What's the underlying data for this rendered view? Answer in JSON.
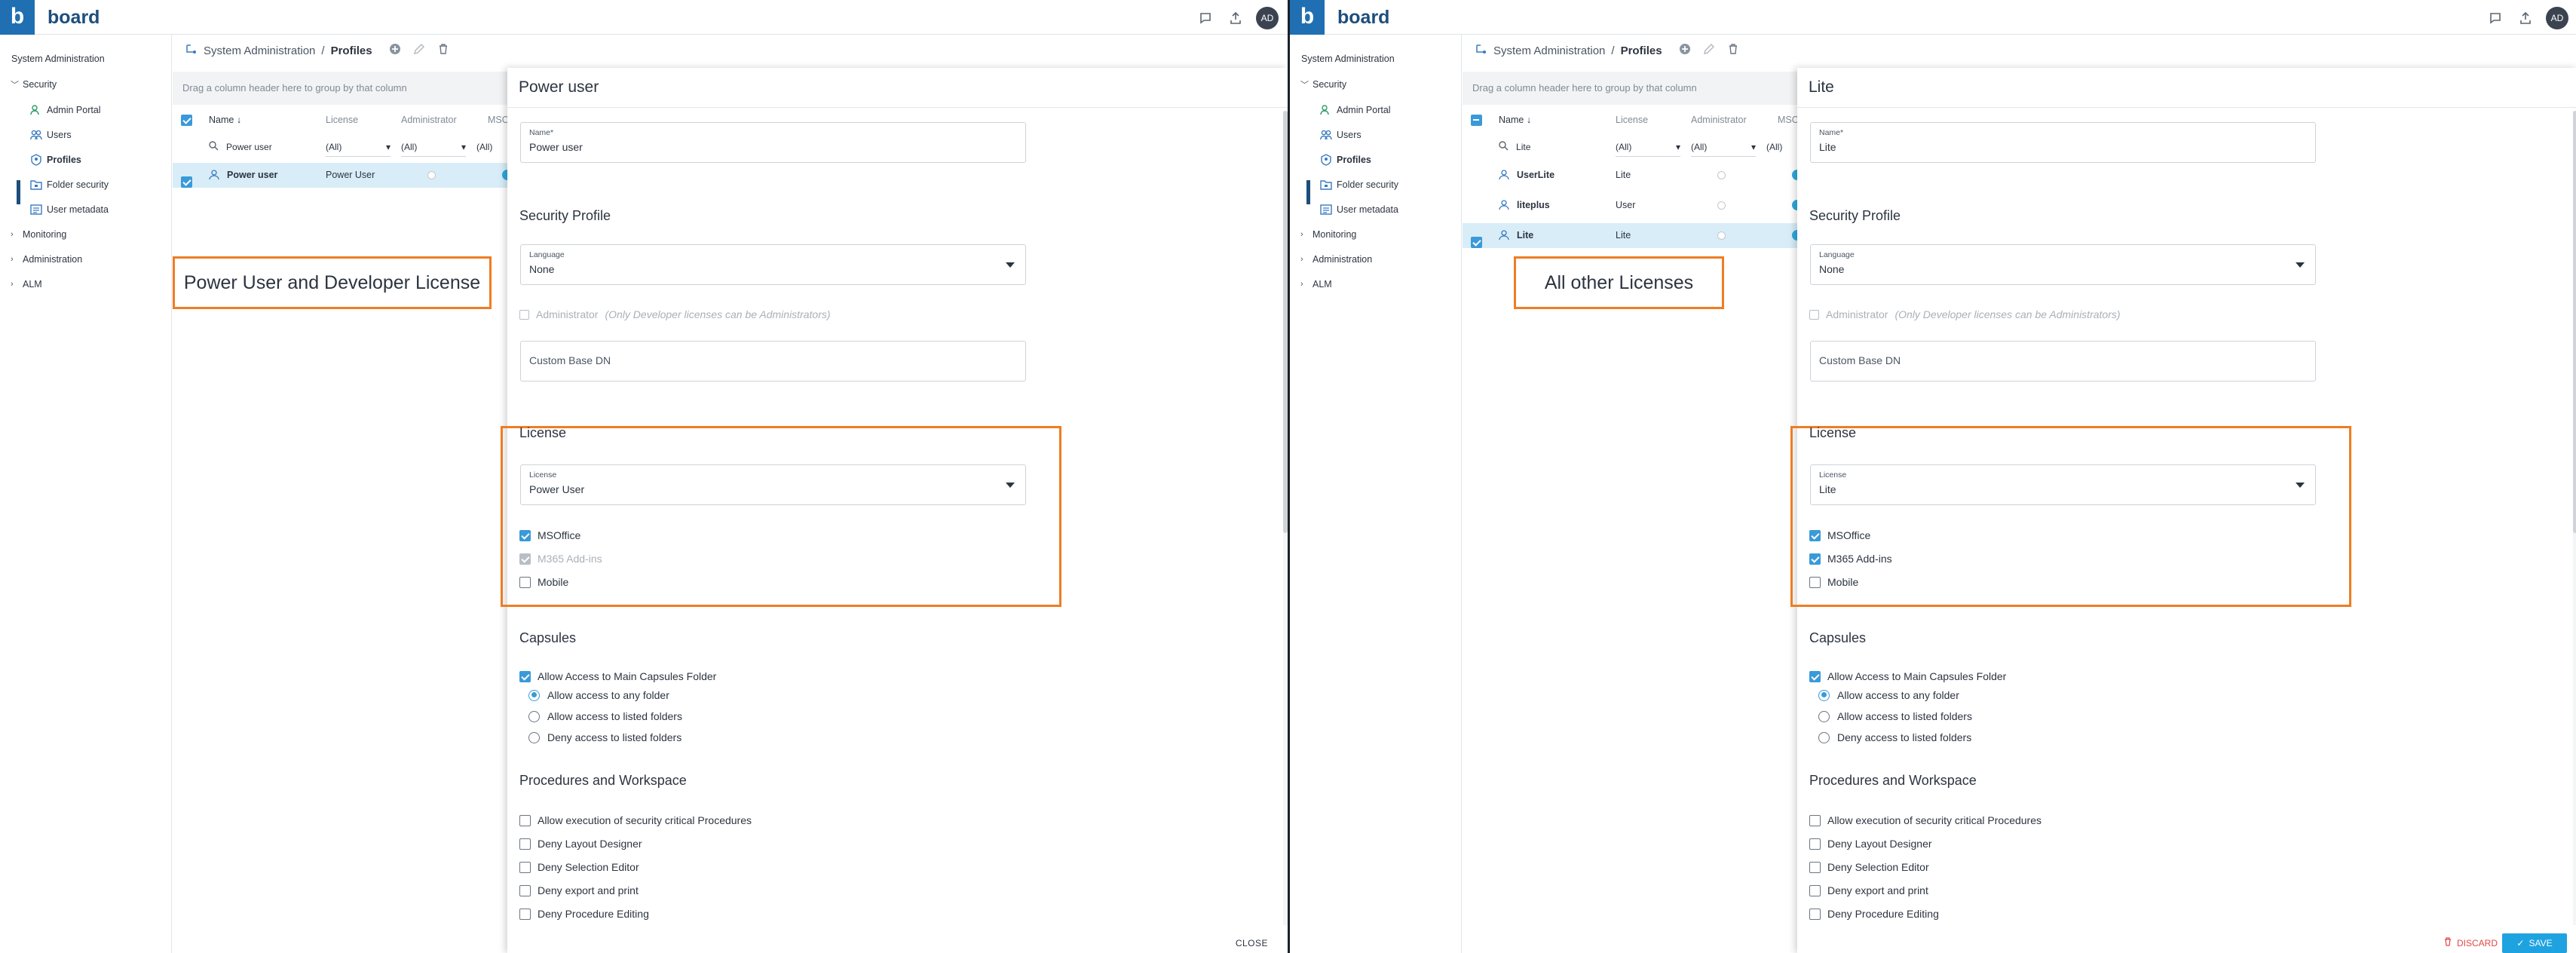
{
  "left": {
    "brand": {
      "logo_letter": "b",
      "logo_text": "board"
    },
    "avatar": "AD",
    "sidebar": {
      "title": "System Administration",
      "security": "Security",
      "items": [
        "Admin Portal",
        "Users",
        "Profiles",
        "Folder security",
        "User metadata"
      ],
      "monitoring": "Monitoring",
      "administration": "Administration",
      "alm": "ALM"
    },
    "breadcrumb": {
      "root": "System Administration",
      "sep": "/",
      "current": "Profiles"
    },
    "grid": {
      "group_hint": "Drag a column header here to group by that column",
      "headers": {
        "name": "Name",
        "license": "License",
        "administrator": "Administrator",
        "mso": "MSO"
      },
      "filter": {
        "name": "Power user",
        "license": "(All)",
        "administrator": "(All)",
        "mso": "(All)"
      },
      "rows": [
        {
          "name": "Power user",
          "license": "Power User"
        }
      ]
    },
    "annotation": "Power User and Developer License",
    "detail": {
      "title": "Power user",
      "name_label": "Name*",
      "name_value": "Power user",
      "security_profile": "Security Profile",
      "language_label": "Language",
      "language_value": "None",
      "admin_label": "Administrator",
      "admin_hint": "(Only Developer licenses can be Administrators)",
      "base_dn": "Custom Base DN",
      "license_section": "License",
      "license_label": "License",
      "license_value": "Power User",
      "msoffice": "MSOffice",
      "m365": "M365 Add-ins",
      "mobile": "Mobile",
      "capsules": "Capsules",
      "allow_main": "Allow Access to Main Capsules Folder",
      "radio_any": "Allow access to any folder",
      "radio_listed": "Allow access to listed folders",
      "radio_deny": "Deny access to listed folders",
      "procedures": "Procedures and Workspace",
      "proc_items": [
        "Allow execution of security critical Procedures",
        "Deny Layout Designer",
        "Deny Selection Editor",
        "Deny export and print",
        "Deny Procedure Editing"
      ],
      "close": "CLOSE"
    }
  },
  "right": {
    "brand": {
      "logo_letter": "b",
      "logo_text": "board"
    },
    "avatar": "AD",
    "sidebar": {
      "title": "System Administration",
      "security": "Security",
      "items": [
        "Admin Portal",
        "Users",
        "Profiles",
        "Folder security",
        "User metadata"
      ],
      "monitoring": "Monitoring",
      "administration": "Administration",
      "alm": "ALM"
    },
    "breadcrumb": {
      "root": "System Administration",
      "sep": "/",
      "current": "Profiles"
    },
    "grid": {
      "group_hint": "Drag a column header here to group by that column",
      "headers": {
        "name": "Name",
        "license": "License",
        "administrator": "Administrator",
        "mso": "MSO"
      },
      "filter": {
        "name": "Lite",
        "license": "(All)",
        "administrator": "(All)",
        "mso": "(All)"
      },
      "rows": [
        {
          "name": "UserLite",
          "license": "Lite"
        },
        {
          "name": "liteplus",
          "license": "User"
        },
        {
          "name": "Lite",
          "license": "Lite"
        }
      ]
    },
    "annotation": "All other Licenses",
    "detail": {
      "title": "Lite",
      "name_label": "Name*",
      "name_value": "Lite",
      "security_profile": "Security Profile",
      "language_label": "Language",
      "language_value": "None",
      "admin_label": "Administrator",
      "admin_hint": "(Only Developer licenses can be Administrators)",
      "base_dn": "Custom Base DN",
      "license_section": "License",
      "license_label": "License",
      "license_value": "Lite",
      "msoffice": "MSOffice",
      "m365": "M365 Add-ins",
      "mobile": "Mobile",
      "capsules": "Capsules",
      "allow_main": "Allow Access to Main Capsules Folder",
      "radio_any": "Allow access to any folder",
      "radio_listed": "Allow access to listed folders",
      "radio_deny": "Deny access to listed folders",
      "procedures": "Procedures and Workspace",
      "proc_items": [
        "Allow execution of security critical Procedures",
        "Deny Layout Designer",
        "Deny Selection Editor",
        "Deny export and print",
        "Deny Procedure Editing"
      ],
      "discard": "DISCARD",
      "save": "SAVE"
    }
  }
}
